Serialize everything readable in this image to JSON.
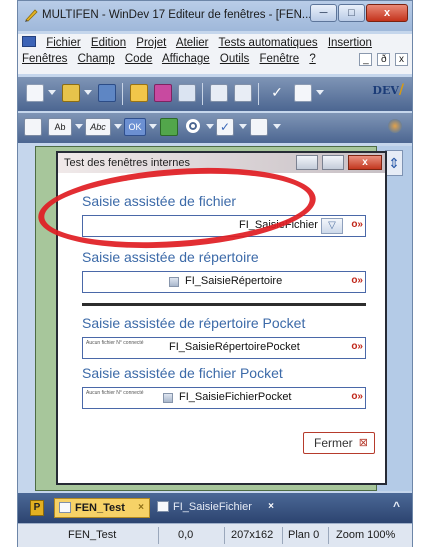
{
  "window": {
    "title": "MULTIFEN - WinDev 17  Editeur de fenêtres - [FEN...",
    "minimize": "─",
    "maximize": "□",
    "close": "x"
  },
  "menu": {
    "row1": [
      "Fichier",
      "Edition",
      "Projet",
      "Atelier",
      "Tests automatiques",
      "Insertion"
    ],
    "row2": [
      "Fenêtres",
      "Champ",
      "Code",
      "Affichage",
      "Outils",
      "Fenêtre",
      "?"
    ],
    "mdi": [
      "_",
      "ð",
      "x"
    ]
  },
  "toolbar": {
    "logo": "DEV",
    "logo_sub": "/",
    "combo_labels": [
      "Ab",
      "Abc",
      "OK"
    ]
  },
  "right_pane": {
    "arrow": "⇕"
  },
  "fen": {
    "title": "Test des fenêtres internes",
    "close": "x",
    "sections": [
      {
        "label": "Saisie assistée de fichier",
        "field": "FI_SaisieFichier",
        "small": "",
        "combo": "▽"
      },
      {
        "label": "Saisie assistée de répertoire",
        "field": "FI_SaisieRépertoire",
        "small": ""
      },
      {
        "label": "Saisie assistée de répertoire Pocket",
        "field": "FI_SaisieRépertoirePocket",
        "small": "Aucun fichier N° connecté"
      },
      {
        "label": "Saisie assistée de fichier Pocket",
        "field": "FI_SaisieFichierPocket",
        "small": "Aucun fichier N° connecté"
      }
    ],
    "field_arrow": "o»",
    "fermer": "Fermer",
    "fermer_x": "⊠"
  },
  "tabs": {
    "lock": "P",
    "active": "FEN_Test",
    "inactive": "FI_SaisieFichier",
    "close": "×",
    "up": "^"
  },
  "status": {
    "name": "FEN_Test",
    "coords": "0,0",
    "size": "207x162",
    "plan": "Plan 0",
    "zoom": "Zoom 100%"
  },
  "colors": {
    "annotation_red": "#e01e24",
    "field_border": "#4a68a8",
    "section_label": "#3c6aa8",
    "active_tab": "#f6d267"
  }
}
